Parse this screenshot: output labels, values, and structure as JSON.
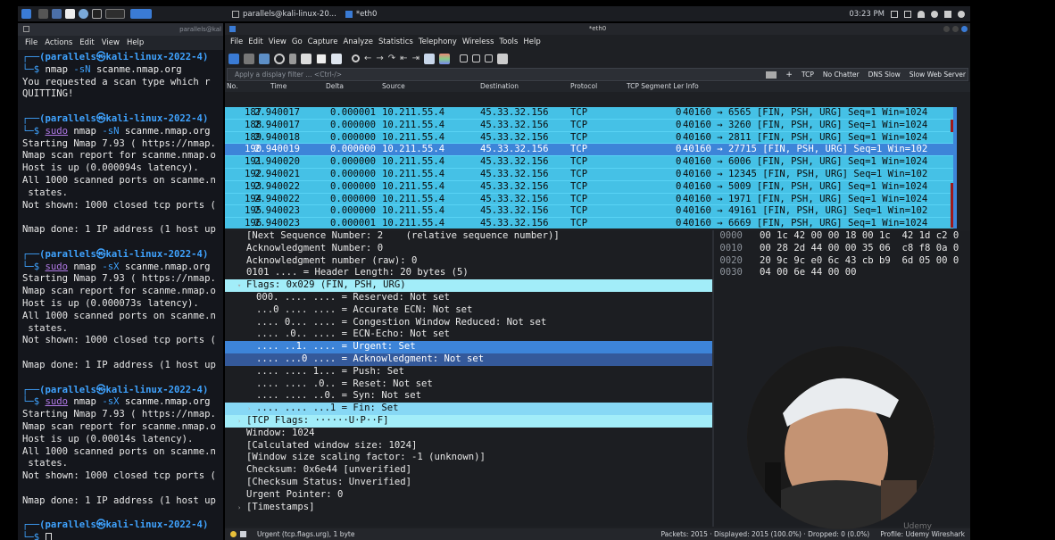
{
  "taskbar": {
    "tasks": [
      "parallels@kali-linux-20...",
      "*eth0"
    ],
    "clock": "03:23 PM"
  },
  "terminal": {
    "title": "parallels@kal",
    "menu": [
      "File",
      "Actions",
      "Edit",
      "View",
      "Help"
    ]
  },
  "wireshark": {
    "title": "*eth0",
    "menu": [
      "File",
      "Edit",
      "View",
      "Go",
      "Capture",
      "Analyze",
      "Statistics",
      "Telephony",
      "Wireless",
      "Tools",
      "Help"
    ],
    "filter_placeholder": "Apply a display filter ... <Ctrl-/>",
    "filter_buttons": [
      "TCP",
      "No Chatter",
      "DNS Slow",
      "Slow Web Server"
    ],
    "columns": [
      "No.",
      "Time",
      "Delta",
      "Source",
      "Destination",
      "Protocol",
      "TCP Segment Ler Info"
    ],
    "packets": [
      {
        "no": "187",
        "time": "2.940017",
        "delta": "0.000001",
        "src": "10.211.55.4",
        "dst": "45.33.32.156",
        "proto": "TCP",
        "len": "0",
        "info": "40160 → 6565 [FIN, PSH, URG] Seq=1 Win=1024"
      },
      {
        "no": "188",
        "time": "2.940017",
        "delta": "0.000000",
        "src": "10.211.55.4",
        "dst": "45.33.32.156",
        "proto": "TCP",
        "len": "0",
        "info": "40160 → 3260 [FIN, PSH, URG] Seq=1 Win=1024"
      },
      {
        "no": "189",
        "time": "2.940018",
        "delta": "0.000000",
        "src": "10.211.55.4",
        "dst": "45.33.32.156",
        "proto": "TCP",
        "len": "0",
        "info": "40160 → 2811 [FIN, PSH, URG] Seq=1 Win=1024"
      },
      {
        "no": "190",
        "time": "2.940019",
        "delta": "0.000000",
        "src": "10.211.55.4",
        "dst": "45.33.32.156",
        "proto": "TCP",
        "len": "0",
        "info": "40160 → 27715 [FIN, PSH, URG] Seq=1 Win=102"
      },
      {
        "no": "191",
        "time": "2.940020",
        "delta": "0.000000",
        "src": "10.211.55.4",
        "dst": "45.33.32.156",
        "proto": "TCP",
        "len": "0",
        "info": "40160 → 6006 [FIN, PSH, URG] Seq=1 Win=1024"
      },
      {
        "no": "192",
        "time": "2.940021",
        "delta": "0.000000",
        "src": "10.211.55.4",
        "dst": "45.33.32.156",
        "proto": "TCP",
        "len": "0",
        "info": "40160 → 12345 [FIN, PSH, URG] Seq=1 Win=102"
      },
      {
        "no": "193",
        "time": "2.940022",
        "delta": "0.000000",
        "src": "10.211.55.4",
        "dst": "45.33.32.156",
        "proto": "TCP",
        "len": "0",
        "info": "40160 → 5009 [FIN, PSH, URG] Seq=1 Win=1024"
      },
      {
        "no": "194",
        "time": "2.940022",
        "delta": "0.000000",
        "src": "10.211.55.4",
        "dst": "45.33.32.156",
        "proto": "TCP",
        "len": "0",
        "info": "40160 → 1971 [FIN, PSH, URG] Seq=1 Win=1024"
      },
      {
        "no": "195",
        "time": "2.940023",
        "delta": "0.000000",
        "src": "10.211.55.4",
        "dst": "45.33.32.156",
        "proto": "TCP",
        "len": "0",
        "info": "40160 → 49161 [FIN, PSH, URG] Seq=1 Win=102"
      },
      {
        "no": "196",
        "time": "2.940023",
        "delta": "0.000001",
        "src": "10.211.55.4",
        "dst": "45.33.32.156",
        "proto": "TCP",
        "len": "0",
        "info": "40160 → 6669 [FIN, PSH, URG] Seq=1 Win=1024"
      }
    ],
    "detail_lines": [
      "[Next Sequence Number: 2    (relative sequence number)]",
      "Acknowledgment Number: 0",
      "Acknowledgment number (raw): 0",
      "0101 .... = Header Length: 20 bytes (5)",
      "Flags: 0x029 (FIN, PSH, URG)",
      "000. .... .... = Reserved: Not set",
      "...0 .... .... = Accurate ECN: Not set",
      ".... 0... .... = Congestion Window Reduced: Not set",
      ".... .0.. .... = ECN-Echo: Not set",
      ".... ..1. .... = Urgent: Set",
      ".... ...0 .... = Acknowledgment: Not set",
      ".... .... 1... = Push: Set",
      ".... .... .0.. = Reset: Not set",
      ".... .... ..0. = Syn: Not set",
      ".... .... ...1 = Fin: Set",
      "[TCP Flags: ······U·P··F]",
      "Window: 1024",
      "[Calculated window size: 1024]",
      "[Window size scaling factor: -1 (unknown)]",
      "Checksum: 0x6e44 [unverified]",
      "[Checksum Status: Unverified]",
      "Urgent Pointer: 0",
      "[Timestamps]"
    ],
    "hex_rows": [
      {
        "offset": "0000",
        "bytes": "00 1c 42 00 00 18 00 1c  42 1d c2 0"
      },
      {
        "offset": "0010",
        "bytes": "00 28 2d 44 00 00 35 06  c8 f8 0a 0"
      },
      {
        "offset": "0020",
        "bytes": "20 9c 9c e0 6c 43 cb b9  6d 05 00 0"
      },
      {
        "offset": "0030",
        "bytes": "04 00 6e 44 00 00"
      }
    ],
    "status_left": "Urgent (tcp.flags.urg), 1 byte",
    "status_packets": "Packets: 2015 · Displayed: 2015 (100.0%) · Dropped: 0 (0.0%)",
    "status_profile": "Profile: Udemy Wireshark"
  },
  "terminal_lines": [
    {
      "t": "prompt",
      "user": "(parallels㉿kali-linux-2022-4)"
    },
    {
      "t": "cmd",
      "pre": "└─$ ",
      "hl": "",
      "cmdname": "nmap",
      "flag": "-sN",
      "rest": " scanme.nmap.org"
    },
    {
      "t": "out",
      "text": "You requested a scan type which r"
    },
    {
      "t": "out",
      "text": "QUITTING!"
    },
    {
      "t": "blank",
      "text": ""
    },
    {
      "t": "prompt",
      "user": "(parallels㉿kali-linux-2022-4)"
    },
    {
      "t": "cmd",
      "pre": "└─$ ",
      "hl": "sudo",
      "cmdname": " nmap",
      "flag": "-sN",
      "rest": " scanme.nmap.org"
    },
    {
      "t": "out",
      "text": "Starting Nmap 7.93 ( https://nmap."
    },
    {
      "t": "out",
      "text": "Nmap scan report for scanme.nmap.o"
    },
    {
      "t": "out",
      "text": "Host is up (0.000094s latency)."
    },
    {
      "t": "out",
      "text": "All 1000 scanned ports on scanme.n"
    },
    {
      "t": "out",
      "text": " states."
    },
    {
      "t": "out",
      "text": "Not shown: 1000 closed tcp ports ("
    },
    {
      "t": "blank",
      "text": ""
    },
    {
      "t": "out",
      "text": "Nmap done: 1 IP address (1 host up"
    },
    {
      "t": "blank",
      "text": ""
    },
    {
      "t": "prompt",
      "user": "(parallels㉿kali-linux-2022-4)"
    },
    {
      "t": "cmd",
      "pre": "└─$ ",
      "hl": "sudo",
      "cmdname": " nmap",
      "flag": "-sX",
      "rest": " scanme.nmap.org"
    },
    {
      "t": "out",
      "text": "Starting Nmap 7.93 ( https://nmap."
    },
    {
      "t": "out",
      "text": "Nmap scan report for scanme.nmap.o"
    },
    {
      "t": "out",
      "text": "Host is up (0.000073s latency)."
    },
    {
      "t": "out",
      "text": "All 1000 scanned ports on scanme.n"
    },
    {
      "t": "out",
      "text": " states."
    },
    {
      "t": "out",
      "text": "Not shown: 1000 closed tcp ports ("
    },
    {
      "t": "blank",
      "text": ""
    },
    {
      "t": "out",
      "text": "Nmap done: 1 IP address (1 host up"
    },
    {
      "t": "blank",
      "text": ""
    },
    {
      "t": "prompt",
      "user": "(parallels㉿kali-linux-2022-4)"
    },
    {
      "t": "cmd",
      "pre": "└─$ ",
      "hl": "sudo",
      "cmdname": " nmap",
      "flag": "-sX",
      "rest": " scanme.nmap.org"
    },
    {
      "t": "out",
      "text": "Starting Nmap 7.93 ( https://nmap."
    },
    {
      "t": "out",
      "text": "Nmap scan report for scanme.nmap.o"
    },
    {
      "t": "out",
      "text": "Host is up (0.00014s latency)."
    },
    {
      "t": "out",
      "text": "All 1000 scanned ports on scanme.n"
    },
    {
      "t": "out",
      "text": " states."
    },
    {
      "t": "out",
      "text": "Not shown: 1000 closed tcp ports ("
    },
    {
      "t": "blank",
      "text": ""
    },
    {
      "t": "out",
      "text": "Nmap done: 1 IP address (1 host up"
    },
    {
      "t": "blank",
      "text": ""
    },
    {
      "t": "prompt",
      "user": "(parallels㉿kali-linux-2022-4)"
    },
    {
      "t": "cursor",
      "pre": "└─$ "
    }
  ],
  "watermark": "Udemy",
  "colors": {
    "packet_row": "#45c1e6",
    "selected": "#3d84d8",
    "flags_header": "#a2edf9"
  }
}
